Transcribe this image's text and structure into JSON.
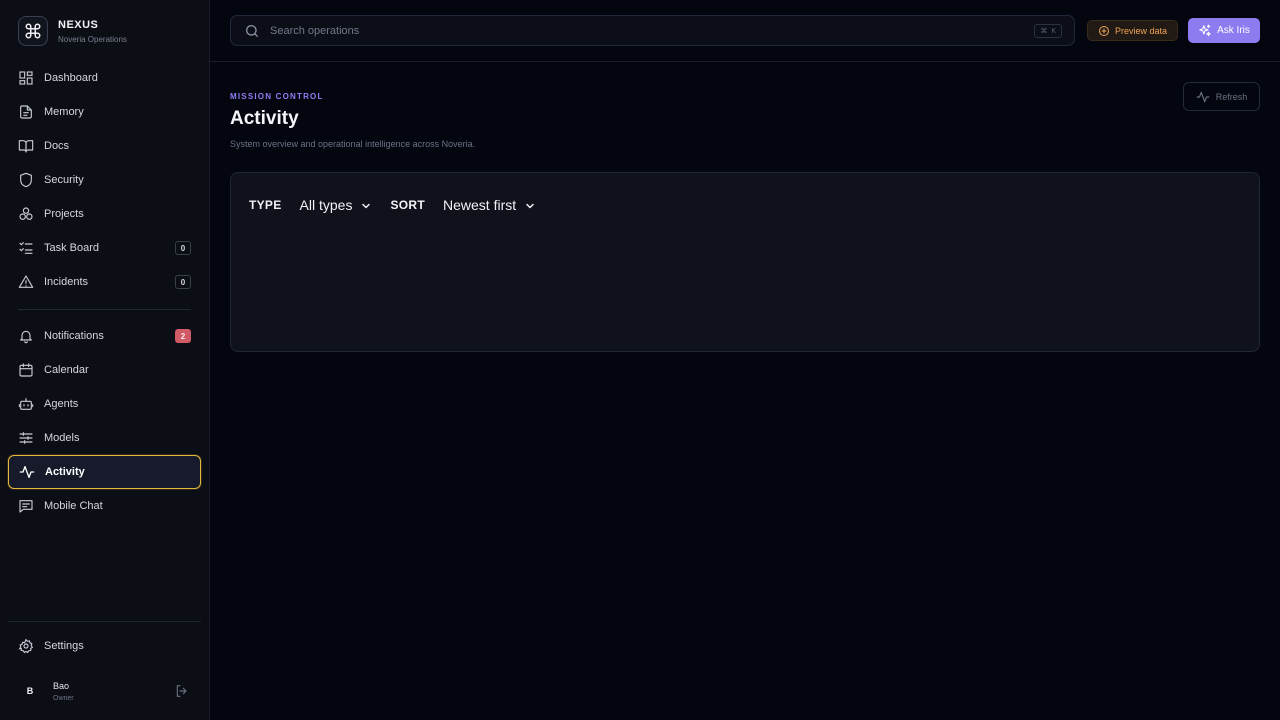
{
  "brand": {
    "name": "NEXUS",
    "subtitle": "Noveria Operations"
  },
  "sidebar": {
    "items": [
      {
        "label": "Dashboard",
        "icon": "dashboard-icon"
      },
      {
        "label": "Memory",
        "icon": "file-icon"
      },
      {
        "label": "Docs",
        "icon": "book-icon"
      },
      {
        "label": "Security",
        "icon": "shield-icon"
      },
      {
        "label": "Projects",
        "icon": "boxes-icon"
      },
      {
        "label": "Task Board",
        "icon": "checklist-icon",
        "badge": "0"
      },
      {
        "label": "Incidents",
        "icon": "warning-icon",
        "badge": "0"
      },
      {
        "label": "Notifications",
        "icon": "bell-icon",
        "badge": "2"
      },
      {
        "label": "Calendar",
        "icon": "calendar-icon"
      },
      {
        "label": "Agents",
        "icon": "bot-icon"
      },
      {
        "label": "Models",
        "icon": "sliders-icon"
      },
      {
        "label": "Activity",
        "icon": "activity-icon",
        "active": true
      },
      {
        "label": "Mobile Chat",
        "icon": "chat-icon"
      }
    ],
    "settings_label": "Settings"
  },
  "user": {
    "initial": "B",
    "name": "Bao",
    "role": "Owner"
  },
  "topbar": {
    "search_placeholder": "Search operations",
    "shortcut_symbol": "⌘",
    "shortcut_key": "K",
    "preview_label": "Preview data",
    "ask_label": "Ask Iris"
  },
  "main": {
    "eyebrow": "MISSION CONTROL",
    "title": "Activity",
    "subtitle": "System overview and operational intelligence across Noveria.",
    "refresh_label": "Refresh",
    "filters": {
      "type_label": "TYPE",
      "type_value": "All types",
      "sort_label": "SORT",
      "sort_value": "Newest first"
    }
  },
  "colors": {
    "accent": "#8c7cf0",
    "active_border": "#e7b73b",
    "warning": "#f1a455",
    "alert_badge": "#d05a66"
  }
}
